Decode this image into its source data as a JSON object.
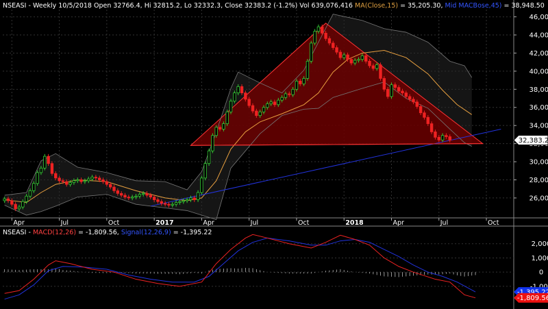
{
  "chart_data": [
    {
      "type": "candlestick",
      "panel": "price",
      "header_parts": [
        {
          "text": "NSEASI - Weekly 10/5/2018 Open 32766.4, Hi 32815.2, Lo 32332.3, Close 32383.2 (-1.2%) Vol 639,076,416 ",
          "color": "#ffffff"
        },
        {
          "text": "MA(Close,15)",
          "color": "#e0a040"
        },
        {
          "text": " = 35,205.30, ",
          "color": "#ffffff"
        },
        {
          "text": "Mid MACBose,45)",
          "color": "#3355ff"
        },
        {
          "text": " = 38,948.50",
          "color": "#ffffff"
        }
      ],
      "ylim": [
        23800,
        46800
      ],
      "yticks": [
        26000,
        28000,
        30000,
        32000,
        34000,
        36000,
        38000,
        40000,
        42000,
        44000,
        46000
      ],
      "ytick_labels": [
        "26,000",
        "28,000",
        "30,000",
        "32,000",
        "34,000",
        "36,000",
        "38,000",
        "40,000",
        "42,000",
        "44,000",
        "46,000"
      ],
      "last_price": {
        "value": 32383.2,
        "label": "32,383.2"
      },
      "x_labels": [
        {
          "week": 2,
          "text": "Apr",
          "bold": false
        },
        {
          "week": 15,
          "text": "Jul",
          "bold": false
        },
        {
          "week": 28,
          "text": "Oct",
          "bold": false
        },
        {
          "week": 41,
          "text": "2017",
          "bold": true
        },
        {
          "week": 54,
          "text": "Apr",
          "bold": false
        },
        {
          "week": 67,
          "text": "Jul",
          "bold": false
        },
        {
          "week": 80,
          "text": "Oct",
          "bold": false
        },
        {
          "week": 93,
          "text": "2018",
          "bold": true
        },
        {
          "week": 106,
          "text": "Apr",
          "bold": false
        },
        {
          "week": 119,
          "text": "Jul",
          "bold": false
        },
        {
          "week": 132,
          "text": "Oct",
          "bold": false
        }
      ],
      "closes": [
        25900,
        25700,
        25300,
        24800,
        25000,
        25600,
        26200,
        26800,
        27600,
        28800,
        29300,
        30600,
        29800,
        28700,
        28200,
        27900,
        27800,
        27500,
        27700,
        27900,
        28000,
        27800,
        27900,
        28100,
        28300,
        28200,
        28000,
        27800,
        27500,
        27200,
        26800,
        26500,
        26300,
        26100,
        26000,
        26100,
        26200,
        26400,
        26500,
        26300,
        26100,
        25800,
        25600,
        25400,
        25300,
        25200,
        25300,
        25500,
        25600,
        25700,
        25800,
        26000,
        25800,
        26600,
        28200,
        29800,
        31200,
        32900,
        33800,
        33600,
        34200,
        35500,
        36700,
        37600,
        38300,
        37600,
        36900,
        36200,
        35600,
        35100,
        35500,
        36000,
        36400,
        36600,
        36300,
        36800,
        37100,
        37500,
        37400,
        38000,
        38900,
        38600,
        39200,
        41100,
        43100,
        44400,
        44900,
        44200,
        43600,
        43100,
        42600,
        42100,
        41500,
        41800,
        41300,
        40900,
        41200,
        41300,
        41700,
        41100,
        40600,
        40300,
        40700,
        39200,
        38000,
        37200,
        38500,
        38200,
        37800,
        37600,
        37200,
        36900,
        36600,
        36100,
        35400,
        34900,
        34200,
        33300,
        32700,
        32400,
        32900,
        32766,
        32383
      ],
      "bands": {
        "upper": [
          [
            0,
            26300
          ],
          [
            6,
            26600
          ],
          [
            10,
            30100
          ],
          [
            14,
            30900
          ],
          [
            20,
            29400
          ],
          [
            28,
            28800
          ],
          [
            36,
            27900
          ],
          [
            44,
            27800
          ],
          [
            50,
            26900
          ],
          [
            54,
            28900
          ],
          [
            58,
            33300
          ],
          [
            62,
            38100
          ],
          [
            64,
            39900
          ],
          [
            70,
            38700
          ],
          [
            76,
            37600
          ],
          [
            82,
            40100
          ],
          [
            86,
            43200
          ],
          [
            90,
            46300
          ],
          [
            98,
            45600
          ],
          [
            104,
            44700
          ],
          [
            110,
            44300
          ],
          [
            116,
            43200
          ],
          [
            122,
            41100
          ],
          [
            126,
            40600
          ],
          [
            128,
            39300
          ]
        ],
        "lower": [
          [
            0,
            25200
          ],
          [
            6,
            24100
          ],
          [
            10,
            24500
          ],
          [
            14,
            25100
          ],
          [
            20,
            26100
          ],
          [
            28,
            26400
          ],
          [
            36,
            25300
          ],
          [
            44,
            24900
          ],
          [
            50,
            24600
          ],
          [
            54,
            24100
          ],
          [
            58,
            23600
          ],
          [
            62,
            29300
          ],
          [
            70,
            33100
          ],
          [
            76,
            35100
          ],
          [
            82,
            35800
          ],
          [
            86,
            35900
          ],
          [
            90,
            37100
          ],
          [
            98,
            38100
          ],
          [
            104,
            38800
          ],
          [
            110,
            37000
          ],
          [
            116,
            35900
          ],
          [
            122,
            33600
          ],
          [
            126,
            32100
          ],
          [
            128,
            31700
          ]
        ]
      },
      "ma15": [
        [
          0,
          25800
        ],
        [
          6,
          25500
        ],
        [
          10,
          26600
        ],
        [
          14,
          27500
        ],
        [
          20,
          28000
        ],
        [
          28,
          27800
        ],
        [
          36,
          26800
        ],
        [
          44,
          26000
        ],
        [
          50,
          25700
        ],
        [
          54,
          26000
        ],
        [
          58,
          27900
        ],
        [
          62,
          31400
        ],
        [
          66,
          33300
        ],
        [
          70,
          34400
        ],
        [
          76,
          35300
        ],
        [
          82,
          36300
        ],
        [
          86,
          37600
        ],
        [
          90,
          39900
        ],
        [
          94,
          41300
        ],
        [
          98,
          42000
        ],
        [
          104,
          42300
        ],
        [
          110,
          41500
        ],
        [
          116,
          39700
        ],
        [
          120,
          37900
        ],
        [
          124,
          36300
        ],
        [
          128,
          35200
        ]
      ],
      "triangle": [
        [
          51,
          31800
        ],
        [
          88,
          45300
        ],
        [
          131,
          32000
        ]
      ],
      "trendline": [
        [
          40,
          25100
        ],
        [
          136,
          33600
        ]
      ],
      "support_line": [
        [
          51,
          31800
        ],
        [
          131,
          32000
        ]
      ]
    },
    {
      "type": "macd",
      "panel": "indicator",
      "header_parts": [
        {
          "text": "NSEASI - ",
          "color": "#ffffff"
        },
        {
          "text": "MACD(12,26)",
          "color": "#ff4040"
        },
        {
          "text": " = -1,809.56, ",
          "color": "#ffffff"
        },
        {
          "text": "Signal(12,26,9)",
          "color": "#3355ff"
        },
        {
          "text": " = -1,395.22",
          "color": "#ffffff"
        }
      ],
      "ylim": [
        -2500,
        3000
      ],
      "yticks": [
        -1000,
        0,
        1000,
        2000
      ],
      "ytick_labels": [
        "-1,000",
        "0",
        "1,000",
        "2,000"
      ],
      "macd_label": {
        "value": -1809.56,
        "label": "-1,809.56"
      },
      "signal_label": {
        "value": -1395.22,
        "label": "-1,395.22"
      },
      "macd": [
        [
          0,
          -1500
        ],
        [
          4,
          -1300
        ],
        [
          8,
          -500
        ],
        [
          12,
          500
        ],
        [
          14,
          800
        ],
        [
          18,
          600
        ],
        [
          24,
          200
        ],
        [
          30,
          0
        ],
        [
          36,
          -500
        ],
        [
          42,
          -800
        ],
        [
          48,
          -1000
        ],
        [
          54,
          -700
        ],
        [
          58,
          600
        ],
        [
          62,
          1600
        ],
        [
          66,
          2400
        ],
        [
          68,
          2650
        ],
        [
          72,
          2400
        ],
        [
          78,
          2000
        ],
        [
          84,
          1700
        ],
        [
          88,
          2100
        ],
        [
          92,
          2600
        ],
        [
          96,
          2300
        ],
        [
          100,
          1900
        ],
        [
          104,
          1000
        ],
        [
          108,
          400
        ],
        [
          112,
          0
        ],
        [
          118,
          -500
        ],
        [
          122,
          -700
        ],
        [
          126,
          -1600
        ],
        [
          129,
          -1810
        ]
      ],
      "signal": [
        [
          0,
          -1900
        ],
        [
          4,
          -1600
        ],
        [
          8,
          -900
        ],
        [
          12,
          100
        ],
        [
          16,
          400
        ],
        [
          22,
          350
        ],
        [
          28,
          200
        ],
        [
          34,
          -200
        ],
        [
          40,
          -500
        ],
        [
          46,
          -700
        ],
        [
          52,
          -700
        ],
        [
          56,
          -300
        ],
        [
          60,
          600
        ],
        [
          64,
          1500
        ],
        [
          68,
          2100
        ],
        [
          72,
          2400
        ],
        [
          78,
          2200
        ],
        [
          84,
          1900
        ],
        [
          88,
          1900
        ],
        [
          92,
          2200
        ],
        [
          96,
          2300
        ],
        [
          100,
          2100
        ],
        [
          104,
          1600
        ],
        [
          108,
          1100
        ],
        [
          112,
          500
        ],
        [
          116,
          0
        ],
        [
          120,
          -300
        ],
        [
          124,
          -700
        ],
        [
          129,
          -1395
        ]
      ]
    }
  ]
}
